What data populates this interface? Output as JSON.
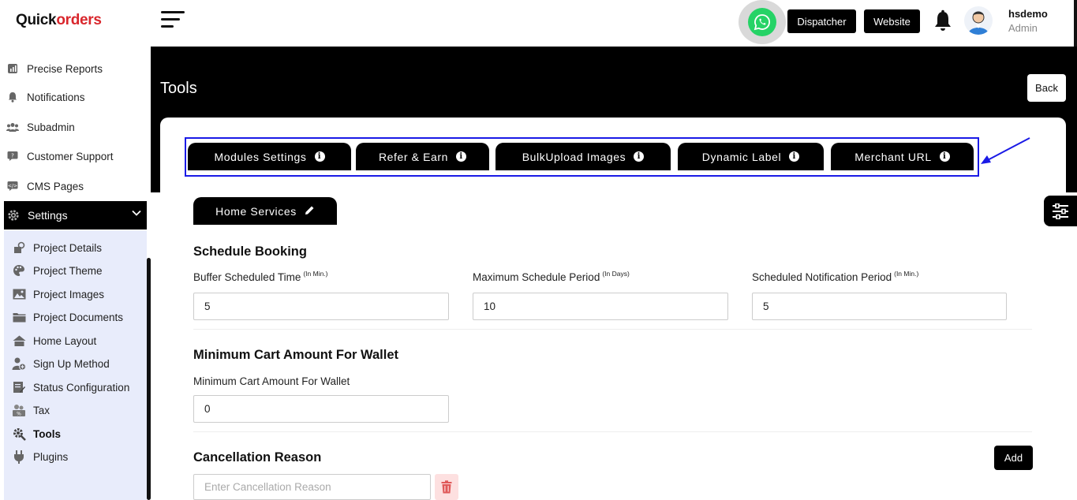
{
  "brand": {
    "part1": "Quick",
    "part2": "orders"
  },
  "nav": [
    {
      "label": "Precise Reports",
      "icon": "chart-icon"
    },
    {
      "label": "Notifications",
      "icon": "bell-icon"
    },
    {
      "label": "Subadmin",
      "icon": "users-icon"
    },
    {
      "label": "Customer Support",
      "icon": "chat-icon"
    },
    {
      "label": "CMS Pages",
      "icon": "pages-icon"
    }
  ],
  "settings": {
    "label": "Settings",
    "icon": "gear-icon"
  },
  "settings_items": [
    {
      "label": "Project Details",
      "icon": "project-details-icon"
    },
    {
      "label": "Project Theme",
      "icon": "palette-icon"
    },
    {
      "label": "Project Images",
      "icon": "image-icon"
    },
    {
      "label": "Project Documents",
      "icon": "folder-icon"
    },
    {
      "label": "Home Layout",
      "icon": "home-icon"
    },
    {
      "label": "Sign Up Method",
      "icon": "user-add-icon"
    },
    {
      "label": "Status Configuration",
      "icon": "edit-list-icon"
    },
    {
      "label": "Tax",
      "icon": "tax-icon"
    },
    {
      "label": "Tools",
      "icon": "tools-icon",
      "active": true
    },
    {
      "label": "Plugins",
      "icon": "plug-icon"
    }
  ],
  "header": {
    "dispatcher": "Dispatcher",
    "website": "Website",
    "username": "hsdemo",
    "role": "Admin"
  },
  "page": {
    "title": "Tools",
    "back": "Back"
  },
  "tabs": [
    "Modules Settings",
    "Refer & Earn",
    "BulkUpload Images",
    "Dynamic Label",
    "Merchant URL"
  ],
  "section_tab": "Home Services",
  "schedule": {
    "heading": "Schedule Booking",
    "fields": [
      {
        "label": "Buffer Scheduled Time",
        "unit": "(In Min.)",
        "value": "5"
      },
      {
        "label": "Maximum Schedule Period",
        "unit": "(In Days)",
        "value": "10"
      },
      {
        "label": "Scheduled Notification Period",
        "unit": "(In Min.)",
        "value": "5"
      }
    ]
  },
  "wallet": {
    "heading": "Minimum Cart Amount For Wallet",
    "label": "Minimum Cart Amount For Wallet",
    "value": "0"
  },
  "cancellation": {
    "heading": "Cancellation Reason",
    "placeholder": "Enter Cancellation Reason",
    "add": "Add"
  },
  "colors": {
    "accent": "#000000",
    "highlight_box": "#1a1ae6",
    "sidebar_sub_bg": "#e8ecfb",
    "whatsapp": "#25d366"
  }
}
